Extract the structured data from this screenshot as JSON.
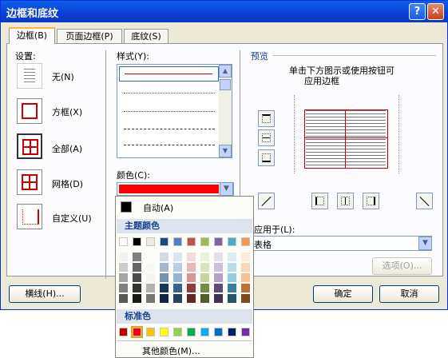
{
  "dialog": {
    "title": "边框和底纹",
    "help": "?",
    "close": "✕"
  },
  "tabs": [
    {
      "label": "边框(B)"
    },
    {
      "label": "页面边框(P)"
    },
    {
      "label": "底纹(S)"
    }
  ],
  "settings": {
    "heading": "设置:",
    "items": [
      {
        "label": "无(N)"
      },
      {
        "label": "方框(X)"
      },
      {
        "label": "全部(A)"
      },
      {
        "label": "网格(D)"
      },
      {
        "label": "自定义(U)"
      }
    ]
  },
  "style": {
    "heading": "样式(Y):",
    "color_label": "颜色(C):",
    "color_value": "#ff0000",
    "line_color": "#cc0000"
  },
  "preview": {
    "heading": "预览",
    "hint_line1": "单击下方图示或使用按钮可",
    "hint_line2": "应用边框"
  },
  "apply": {
    "label": "应用于(L):",
    "value": "表格",
    "options_button": "选项(O)..."
  },
  "buttons": {
    "hline": "横线(H)...",
    "ok": "确定",
    "cancel": "取消"
  },
  "color_menu": {
    "auto_label": "自动(A)",
    "theme_heading": "主题颜色",
    "theme_colors": [
      "#ffffff",
      "#000000",
      "#eeece1",
      "#1f497d",
      "#4f81bd",
      "#c0504d",
      "#9bbb59",
      "#8064a2",
      "#4bacc6",
      "#f79646"
    ],
    "standard_heading": "标准色",
    "standard_colors": [
      "#c00000",
      "#ff0000",
      "#ffc000",
      "#ffff00",
      "#92d050",
      "#00b050",
      "#00b0f0",
      "#0070c0",
      "#002060",
      "#7030a0"
    ],
    "selected_standard": "#ff0000",
    "more_colors": "其他颜色(M)..."
  }
}
